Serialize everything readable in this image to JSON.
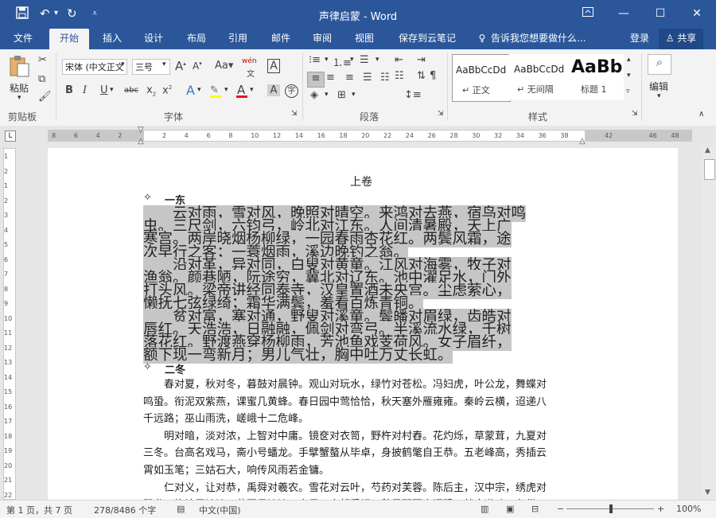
{
  "window": {
    "title": "声律启蒙 - Word",
    "quick_access": [
      "save-icon",
      "undo-icon",
      "redo-icon",
      "customize-icon"
    ]
  },
  "tabs": [
    "文件",
    "开始",
    "插入",
    "设计",
    "布局",
    "引用",
    "邮件",
    "审阅",
    "视图",
    "保存到云笔记"
  ],
  "tell_me": "告诉我您想要做什么...",
  "account": {
    "login": "登录",
    "share": "共享"
  },
  "ribbon": {
    "clipboard": {
      "paste": "粘贴",
      "label": "剪贴板"
    },
    "font": {
      "name": "宋体 (中文正文",
      "size": "三号",
      "label": "字体",
      "wen": "wén",
      "letter_a": "A",
      "aa": "Aa"
    },
    "paragraph": {
      "label": "段落"
    },
    "styles": {
      "label": "样式",
      "items": [
        {
          "sample": "AaBbCcDd",
          "name": "↵ 正文"
        },
        {
          "sample": "AaBbCcDd",
          "name": "↵ 无间隔"
        },
        {
          "sample": "AaBb",
          "name": "标题 1"
        }
      ]
    },
    "editing": {
      "label": "编辑"
    }
  },
  "ruler": {
    "h_ticks": [
      "8",
      "6",
      "4",
      "2",
      "",
      "2",
      "4",
      "6",
      "8",
      "10",
      "12",
      "14",
      "16",
      "18",
      "20",
      "22",
      "24",
      "26",
      "28",
      "30",
      "32",
      "34",
      "36",
      "38",
      "",
      "42",
      "",
      "46",
      "48"
    ],
    "v_ticks": [
      "1",
      "2",
      "1",
      "2",
      "3",
      "4",
      "5",
      "6",
      "7",
      "8",
      "9",
      "10",
      "11",
      "12",
      "13",
      "14",
      "15",
      "16",
      "17",
      "18",
      "19",
      "20",
      "21",
      "22"
    ]
  },
  "document": {
    "section_title": "上卷",
    "heading1": "一东",
    "para1": [
      "　　云对雨，雪对风，晚照对晴空。来鸿对去燕，宿鸟对鸣",
      "虫。三尺剑，六钧弓，岭北对江东。人间清暑殿，天上广",
      "寒宫。两岸晓烟杨柳绿，一园春雨杏花红。两鬓风霜，途",
      "次早行之客；一蓑烟雨，溪边晚钓之翁。",
      "　　沿对革，异对同，白叟对黄童。江风对海雾，牧子对",
      "渔翁。颜巷陋，阮途穷，冀北对辽东。池中濯足水，门外",
      "打头风。梁帝讲经同泰寺，汉皇置酒未央宫。尘虑萦心，",
      "懒抚七弦绿绮；霜华满鬓，羞看百炼青铜。",
      "　　贫对富，塞对通，野叟对溪童。鬓皤对眉绿，齿皓对",
      "唇红。天浩浩，日融融，佩剑对弯弓。半溪流水绿，千树",
      "落花红。野渡燕穿杨柳雨，芳池鱼戏芰荷风。女子眉纤，",
      "额下现一弯新月；男儿气壮，胸中吐万丈长虹。"
    ],
    "heading2": "二冬",
    "para2": [
      "　　春对夏，秋对冬，暮鼓对晨钟。观山对玩水，绿竹对苍松。冯妇虎，叶公龙，舞蝶对",
      "鸣蛩。衔泥双紫燕，课蜜几黄蜂。春日园中莺恰恰，秋天塞外雁雍雍。秦岭云横，迢递八",
      "千远路；巫山雨洗，嵯峨十二危峰。",
      "　　明对暗，淡对浓，上智对中庸。镜奁对衣笥，野杵对村舂。花灼烁，草蒙茸，九夏对",
      "三冬。台高名戏马，斋小号蟠龙。手擘蟹螯从毕卓，身披鹤氅自王恭。五老峰高，秀插云",
      "霄如玉笔；三姑石大，响传风雨若金镛。",
      "　　仁对义，让对恭，禹舜对羲农。雪花对云叶，芍药对芙蓉。陈后主，汉中宗，绣虎对",
      "雕龙。柳塘风淡淡，花圃月浓浓。春日正宜朝看蝶，秋风那更夜闻蛩。战士邀功，必借干"
    ]
  },
  "status": {
    "page": "第 1 页，共 7 页",
    "words": "278/8486 个字",
    "language": "中文(中国)",
    "zoom": "100%",
    "minus": "−",
    "plus": "+"
  },
  "colors": {
    "titlebar": "#2b579a",
    "highlight": "#c6c6c6",
    "font_red": "#e81123"
  }
}
